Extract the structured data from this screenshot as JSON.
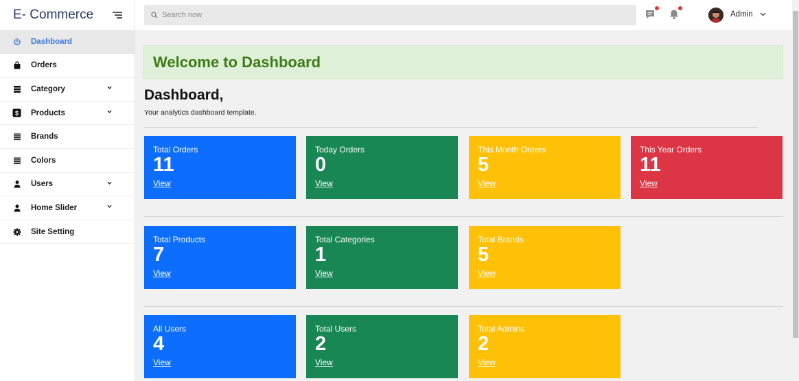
{
  "sidebar": {
    "brand": "E- Commerce",
    "items": [
      {
        "label": "Dashboard",
        "icon": "power-icon",
        "has_caret": false,
        "active": true
      },
      {
        "label": "Orders",
        "icon": "bag-icon",
        "has_caret": false,
        "active": false
      },
      {
        "label": "Category",
        "icon": "list-icon",
        "has_caret": true,
        "active": false
      },
      {
        "label": "Products",
        "icon": "dollar-icon",
        "has_caret": true,
        "active": false
      },
      {
        "label": "Brands",
        "icon": "lines-icon",
        "has_caret": false,
        "active": false
      },
      {
        "label": "Colors",
        "icon": "lines-icon",
        "has_caret": false,
        "active": false
      },
      {
        "label": "Users",
        "icon": "user-icon",
        "has_caret": true,
        "active": false
      },
      {
        "label": "Home Slider",
        "icon": "user-icon",
        "has_caret": true,
        "active": false
      },
      {
        "label": "Site Setting",
        "icon": "gear-icon",
        "has_caret": false,
        "active": false
      }
    ]
  },
  "topbar": {
    "search_placeholder": "Search now",
    "user_name": "Admin"
  },
  "main": {
    "welcome": "Welcome to Dashboard",
    "title": "Dashboard,",
    "subtitle": "Your analytics dashboard template.",
    "row1": [
      {
        "label": "Total Orders",
        "value": "11",
        "link": "View",
        "color": "#0d6efd"
      },
      {
        "label": "Today Orders",
        "value": "0",
        "link": "View",
        "color": "#198754"
      },
      {
        "label": "This Month Orders",
        "value": "5",
        "link": "View",
        "color": "#ffc107"
      },
      {
        "label": "This Year Orders",
        "value": "11",
        "link": "View",
        "color": "#dc3545"
      }
    ],
    "row2": [
      {
        "label": "Total Products",
        "value": "7",
        "link": "View",
        "color": "#0d6efd"
      },
      {
        "label": "Total Categories",
        "value": "1",
        "link": "View",
        "color": "#198754"
      },
      {
        "label": "Total Brands",
        "value": "5",
        "link": "View",
        "color": "#ffc107"
      }
    ],
    "row3": [
      {
        "label": "All Users",
        "value": "4",
        "link": "View",
        "color": "#0d6efd"
      },
      {
        "label": "Total Users",
        "value": "2",
        "link": "View",
        "color": "#198754"
      },
      {
        "label": "Total Admins",
        "value": "2",
        "link": "View",
        "color": "#ffc107"
      }
    ]
  },
  "colors": {
    "accent": "#3d7be0",
    "welcome_bg": "#dff0d8",
    "welcome_text": "#3c7b16"
  }
}
